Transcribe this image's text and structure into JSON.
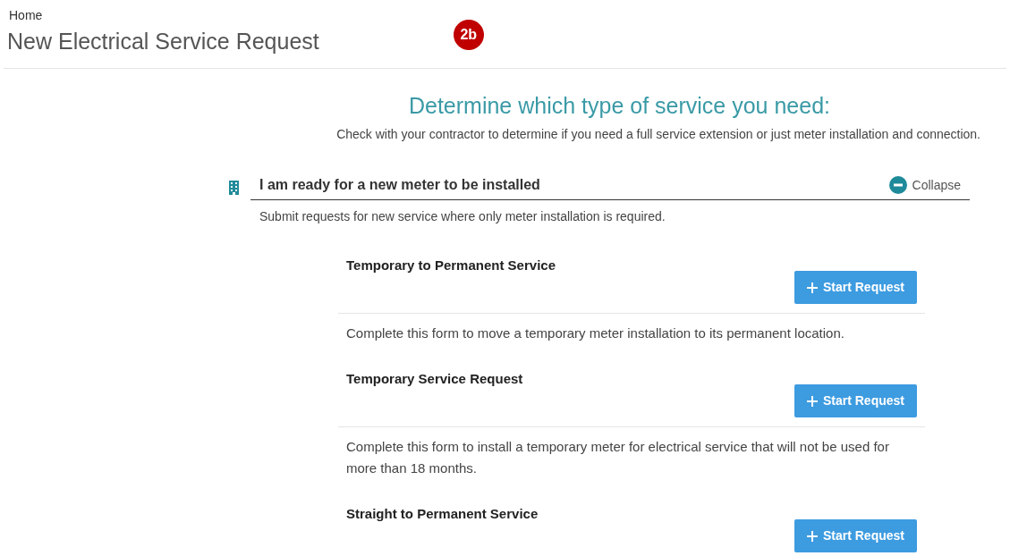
{
  "breadcrumb": "Home",
  "title": "New Electrical Service Request",
  "badge": "2b",
  "heading": "Determine which type of service you need:",
  "subheading": "Check with your contractor to determine if you need a full service extension or just meter installation and connection.",
  "section": {
    "title": "I am ready for a new meter to be installed",
    "toggle": "Collapse",
    "expanded": true,
    "description": "Submit requests for new service where only meter installation is required.",
    "items": [
      {
        "title": "Temporary to Permanent Service",
        "button": "Start Request",
        "description": "Complete this form to move a temporary meter installation to its permanent location."
      },
      {
        "title": "Temporary Service Request",
        "button": "Start Request",
        "description": "Complete this form to install a temporary meter for electrical service that will not be used for more than 18 months."
      },
      {
        "title": "Straight to Permanent Service",
        "button": "Start Request"
      }
    ]
  }
}
